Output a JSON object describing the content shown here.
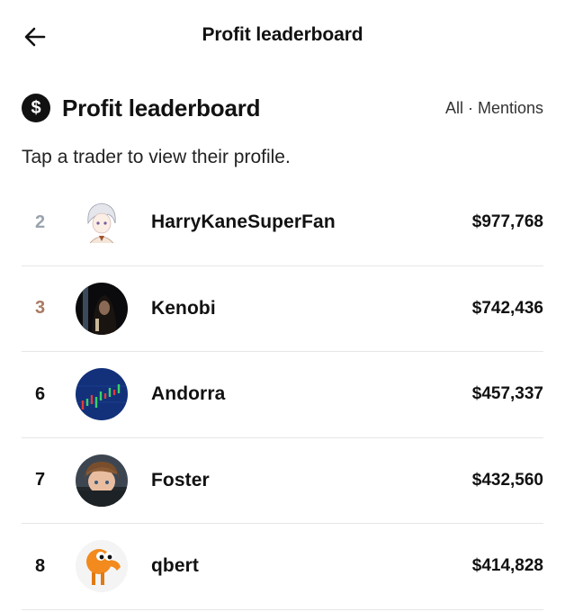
{
  "header": {
    "title": "Profit leaderboard"
  },
  "section": {
    "icon": "dollar-circle-icon",
    "title": "Profit leaderboard",
    "filter_label": "All · Mentions"
  },
  "subtitle": "Tap a trader to view their profile.",
  "traders": [
    {
      "rank": "2",
      "name": "HarryKaneSuperFan",
      "profit": "$977,768",
      "rank_color": "#9aa3ad"
    },
    {
      "rank": "3",
      "name": "Kenobi",
      "profit": "$742,436",
      "rank_color": "#a97a62"
    },
    {
      "rank": "6",
      "name": "Andorra",
      "profit": "$457,337",
      "rank_color": "#111111"
    },
    {
      "rank": "7",
      "name": "Foster",
      "profit": "$432,560",
      "rank_color": "#111111"
    },
    {
      "rank": "8",
      "name": "qbert",
      "profit": "$414,828",
      "rank_color": "#111111"
    }
  ]
}
